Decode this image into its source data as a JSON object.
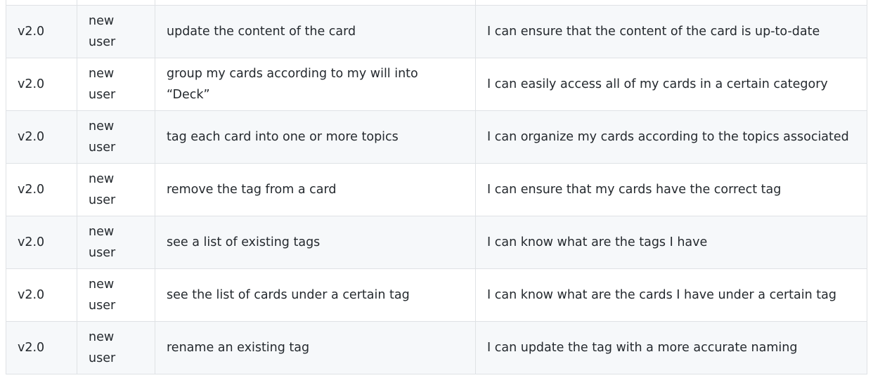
{
  "table": {
    "rows": [
      {
        "version": "",
        "role": "",
        "want": "",
        "benefit": ""
      },
      {
        "version": "v2.0",
        "role": "new user",
        "want": "update the content of the card",
        "benefit": "I can ensure that the content of the card is up-to-date"
      },
      {
        "version": "v2.0",
        "role": "new user",
        "want": "group my cards according to my will into “Deck”",
        "benefit": "I can easily access all of my cards in a certain category"
      },
      {
        "version": "v2.0",
        "role": "new user",
        "want": "tag each card into one or more topics",
        "benefit": "I can organize my cards according to the topics associated"
      },
      {
        "version": "v2.0",
        "role": "new user",
        "want": "remove the tag from a card",
        "benefit": "I can ensure that my cards have the correct tag"
      },
      {
        "version": "v2.0",
        "role": "new user",
        "want": "see a list of existing tags",
        "benefit": "I can know what are the tags I have"
      },
      {
        "version": "v2.0",
        "role": "new user",
        "want": "see the list of cards under a certain tag",
        "benefit": "I can know what are the cards I have under a certain tag"
      },
      {
        "version": "v2.0",
        "role": "new user",
        "want": "rename an existing tag",
        "benefit": "I can update the tag with a more accurate naming"
      }
    ]
  }
}
